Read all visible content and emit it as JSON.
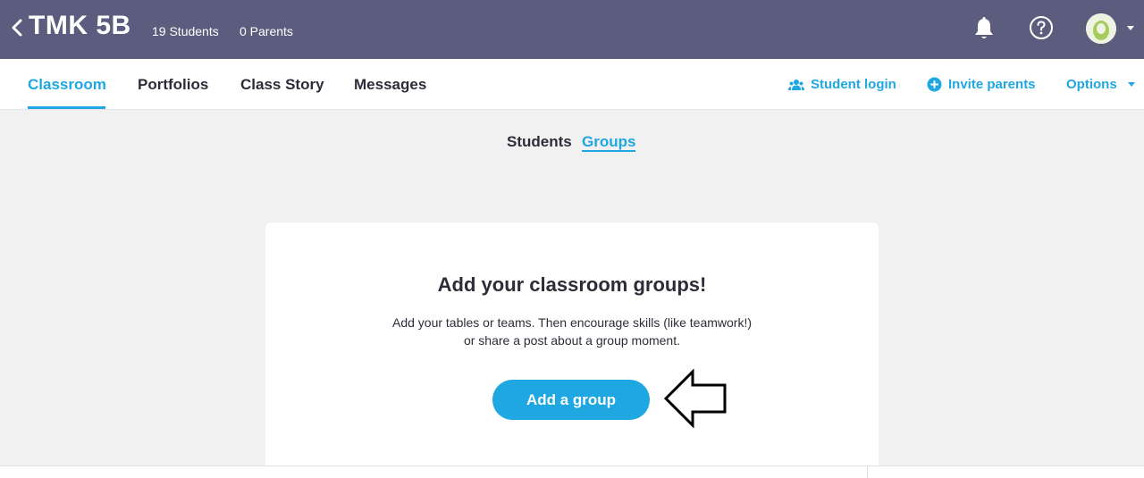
{
  "header": {
    "class_name": "TMK 5B",
    "students": "19 Students",
    "parents": "0 Parents"
  },
  "nav": {
    "tabs": [
      {
        "label": "Classroom",
        "active": true
      },
      {
        "label": "Portfolios",
        "active": false
      },
      {
        "label": "Class Story",
        "active": false
      },
      {
        "label": "Messages",
        "active": false
      }
    ],
    "actions": {
      "student_login": "Student login",
      "invite_parents": "Invite parents",
      "options": "Options"
    }
  },
  "subtabs": {
    "students": "Students",
    "groups": "Groups",
    "active": "groups"
  },
  "card": {
    "heading": "Add your classroom groups!",
    "desc_line1": "Add your tables or teams. Then encourage skills (like teamwork!)",
    "desc_line2": "or share a post about a group moment.",
    "button": "Add a group"
  },
  "icons": {
    "back": "chevron-left-icon",
    "bell": "bell-icon",
    "help": "help-icon",
    "student_login": "students-icon",
    "invite": "plus-circle-icon",
    "pointer": "arrow-left-outline-icon"
  },
  "colors": {
    "header_bg": "#5c5d7e",
    "accent": "#1fa7e1",
    "page_bg": "#f1f1f2",
    "text": "#2d2d3a"
  }
}
